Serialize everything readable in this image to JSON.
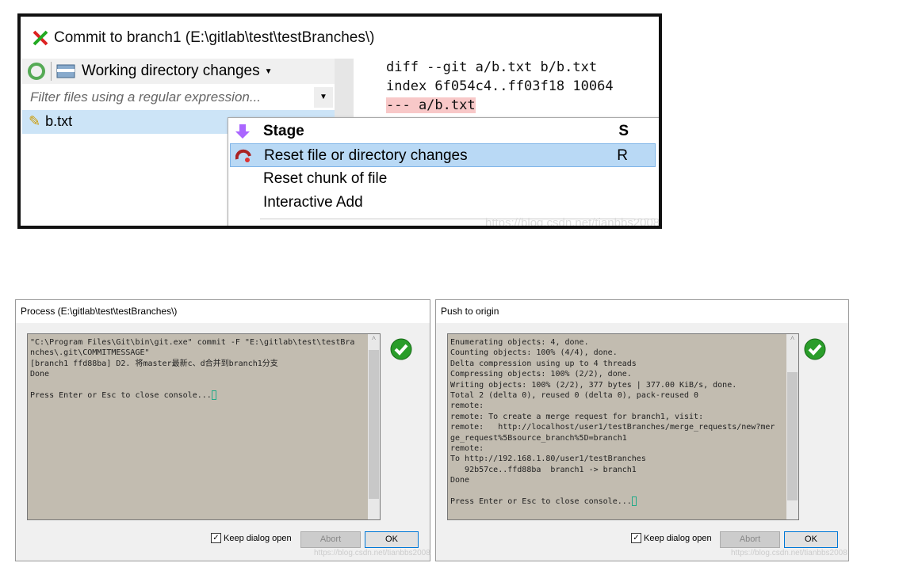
{
  "commit_window": {
    "title": "Commit to branch1 (E:\\gitlab\\test\\testBranches\\)",
    "toolbar_label": "Working directory changes",
    "filter_placeholder": "Filter files using a regular expression...",
    "file": "b.txt",
    "diff_lines": [
      "diff --git a/b.txt b/b.txt",
      "index 6f054c4..ff03f18 10064",
      "--- a/b.txt"
    ],
    "context_menu": [
      {
        "label": "Stage",
        "shortcut": "S",
        "icon": "arrow-down-icon"
      },
      {
        "label": "Reset file or directory changes",
        "shortcut": "R",
        "icon": "reset-icon",
        "selected": true
      },
      {
        "label": "Reset chunk of file",
        "shortcut": ""
      },
      {
        "label": "Interactive Add",
        "shortcut": ""
      }
    ],
    "watermark": "https://blog.csdn.net/tianbbs2008"
  },
  "process_dialog": {
    "title": "Process (E:\\gitlab\\test\\testBranches\\)",
    "console": "\"C:\\Program Files\\Git\\bin\\git.exe\" commit -F \"E:\\gitlab\\test\\testBra\nnches\\.git\\COMMITMESSAGE\"\n[branch1 ffd88ba] D2. 将master最新c、d合并到branch1分支\nDone\n\nPress Enter or Esc to close console...",
    "keep_open_label": "Keep dialog open",
    "keep_open": true,
    "abort_label": "Abort",
    "ok_label": "OK",
    "watermark": "https://blog.csdn.net/tianbbs2008"
  },
  "push_dialog": {
    "title": "Push to origin",
    "console": "Enumerating objects: 4, done.\nCounting objects: 100% (4/4), done.\nDelta compression using up to 4 threads\nCompressing objects: 100% (2/2), done.\nWriting objects: 100% (2/2), 377 bytes | 377.00 KiB/s, done.\nTotal 2 (delta 0), reused 0 (delta 0), pack-reused 0\nremote:\nremote: To create a merge request for branch1, visit:\nremote:   http://localhost/user1/testBranches/merge_requests/new?mer\nge_request%5Bsource_branch%5D=branch1\nremote:\nTo http://192.168.1.80/user1/testBranches\n   92b57ce..ffd88ba  branch1 -> branch1\nDone\n\nPress Enter or Esc to close console...",
    "keep_open_label": "Keep dialog open",
    "keep_open": true,
    "abort_label": "Abort",
    "ok_label": "OK",
    "watermark": "https://blog.csdn.net/tianbbs2008"
  },
  "colors": {
    "console_bg": "#c2bcb0",
    "selection": "#b9d9f5",
    "success": "#2a9d2a",
    "diff_removed": "#f8c8c8"
  }
}
